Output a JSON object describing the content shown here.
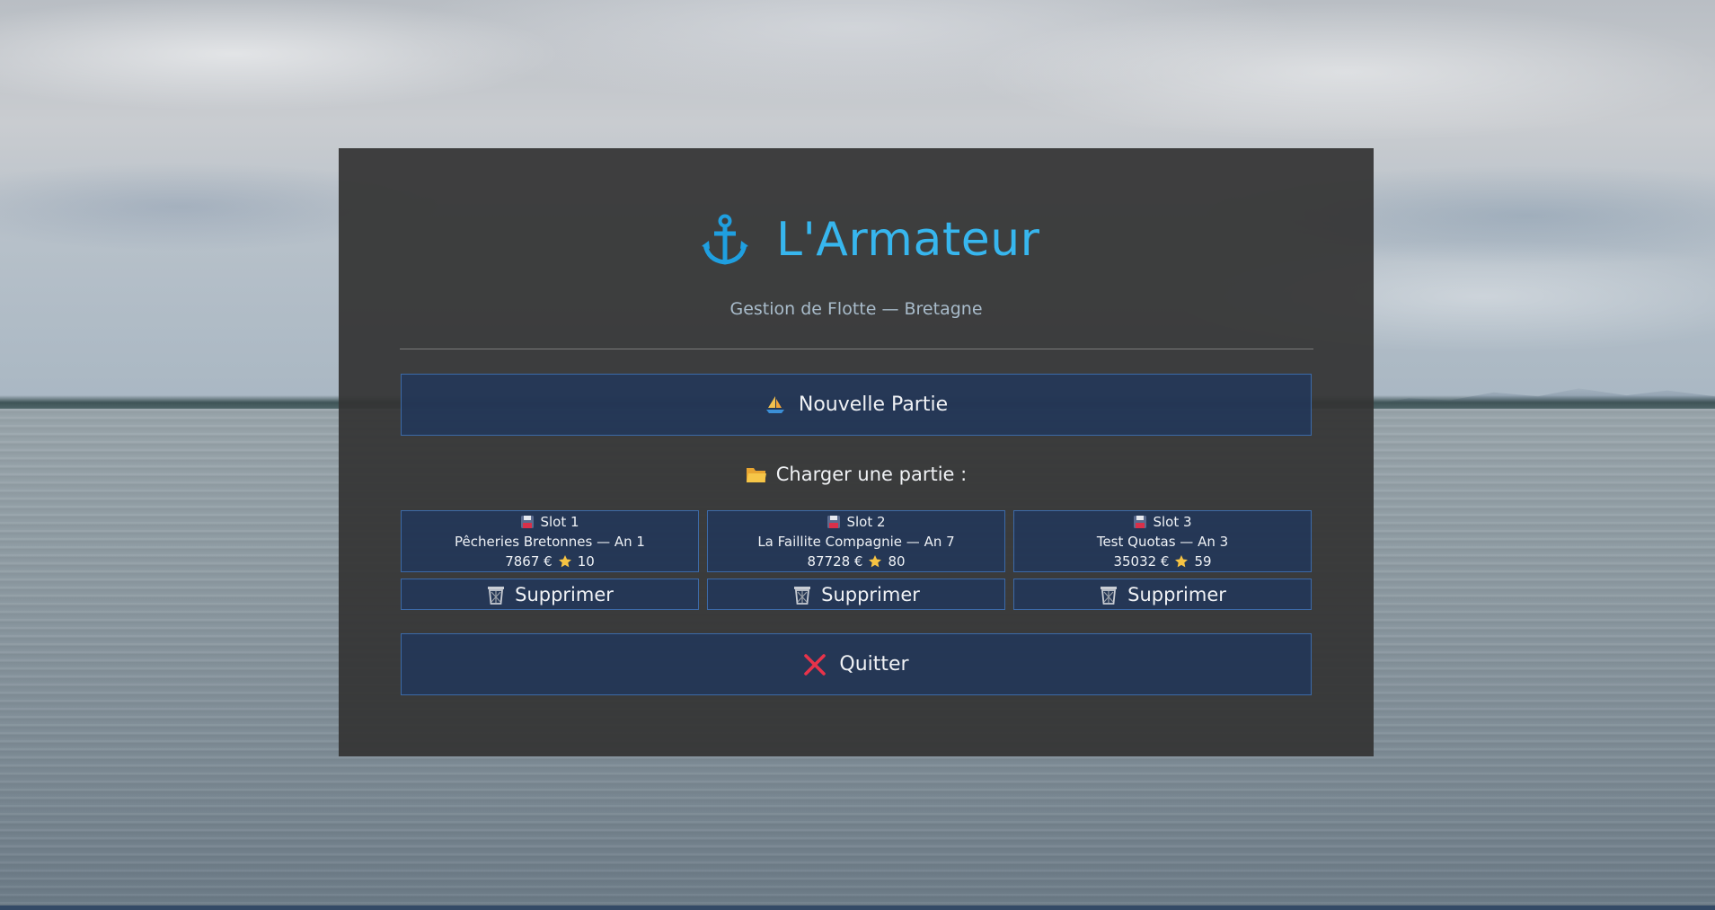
{
  "app": {
    "title": "L'Armateur",
    "subtitle": "Gestion de Flotte — Bretagne",
    "accent_color": "#37b6ee",
    "title_icon": "anchor-icon"
  },
  "menu": {
    "new_game": {
      "label": "Nouvelle Partie",
      "icon": "sailboat-icon"
    },
    "load_label": {
      "label": "Charger une partie :",
      "icon": "folder-icon"
    },
    "quit": {
      "label": "Quitter",
      "icon": "cross-icon",
      "icon_color": "#e8334a"
    }
  },
  "slots": [
    {
      "name": "Slot 1",
      "company": "Pêcheries Bretonnes — An 1",
      "money": "7867 €",
      "rating": "10",
      "delete_label": "Supprimer"
    },
    {
      "name": "Slot 2",
      "company": "La Faillite Compagnie — An 7",
      "money": "87728 €",
      "rating": "80",
      "delete_label": "Supprimer"
    },
    {
      "name": "Slot 3",
      "company": "Test Quotas — An 3",
      "money": "35032 €",
      "rating": "59",
      "delete_label": "Supprimer"
    }
  ]
}
